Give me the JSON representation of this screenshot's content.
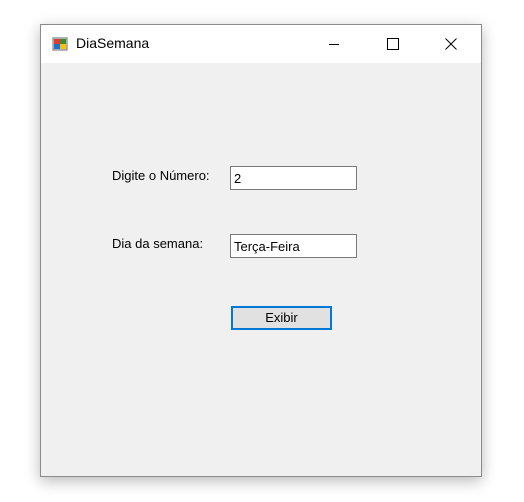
{
  "window": {
    "title": "DiaSemana",
    "controls": {
      "minimize": "minimize-icon",
      "maximize": "maximize-icon",
      "close": "close-icon"
    }
  },
  "form": {
    "number_label": "Digite o Número:",
    "number_value": "2",
    "weekday_label": "Dia da semana:",
    "weekday_value": "Terça-Feira",
    "show_button": "Exibir"
  },
  "colors": {
    "form_background": "#f0f0f0",
    "title_bar": "#ffffff",
    "button_focus_border": "#0078d7",
    "button_background": "#e1e1e1"
  }
}
